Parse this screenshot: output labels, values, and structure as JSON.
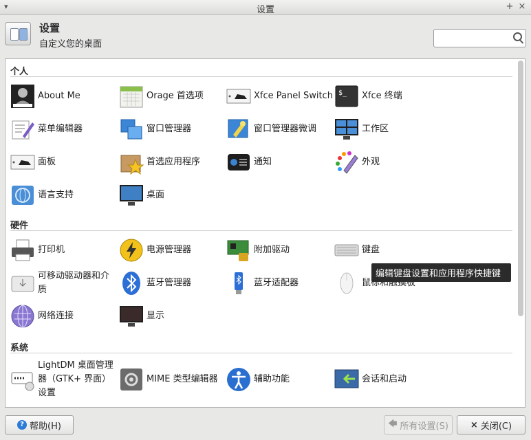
{
  "window": {
    "title": "设置"
  },
  "header": {
    "title": "设置",
    "subtitle": "自定义您的桌面",
    "search_placeholder": ""
  },
  "sections": [
    {
      "title": "个人",
      "items": [
        {
          "label": "About Me",
          "icon": "about-me-icon"
        },
        {
          "label": "Orage 首选项",
          "icon": "calendar-icon"
        },
        {
          "label": "Xfce Panel Switch",
          "icon": "panel-switch-icon"
        },
        {
          "label": "Xfce 终端",
          "icon": "terminal-icon"
        },
        {
          "label": "菜单编辑器",
          "icon": "menu-editor-icon"
        },
        {
          "label": "窗口管理器",
          "icon": "window-manager-icon"
        },
        {
          "label": "窗口管理器微调",
          "icon": "window-tweaks-icon"
        },
        {
          "label": "工作区",
          "icon": "workspaces-icon"
        },
        {
          "label": "面板",
          "icon": "panel-icon"
        },
        {
          "label": "首选应用程序",
          "icon": "preferred-apps-icon"
        },
        {
          "label": "通知",
          "icon": "notifications-icon"
        },
        {
          "label": "外观",
          "icon": "appearance-icon"
        },
        {
          "label": "语言支持",
          "icon": "language-icon"
        },
        {
          "label": "桌面",
          "icon": "desktop-icon"
        }
      ]
    },
    {
      "title": "硬件",
      "items": [
        {
          "label": "打印机",
          "icon": "printer-icon"
        },
        {
          "label": "电源管理器",
          "icon": "power-icon"
        },
        {
          "label": "附加驱动",
          "icon": "drivers-icon"
        },
        {
          "label": "键盘",
          "icon": "keyboard-icon"
        },
        {
          "label": "可移动驱动器和介质",
          "icon": "removable-drive-icon"
        },
        {
          "label": "蓝牙管理器",
          "icon": "bluetooth-icon"
        },
        {
          "label": "蓝牙适配器",
          "icon": "bluetooth-adapter-icon"
        },
        {
          "label": "鼠标和触摸板",
          "icon": "mouse-icon"
        },
        {
          "label": "网络连接",
          "icon": "network-icon"
        },
        {
          "label": "显示",
          "icon": "display-icon"
        }
      ]
    },
    {
      "title": "系统",
      "items": [
        {
          "label": "LightDM 桌面管理器（GTK+ 界面）设置",
          "icon": "lightdm-icon"
        },
        {
          "label": "MIME 类型编辑器",
          "icon": "mime-icon"
        },
        {
          "label": "辅助功能",
          "icon": "accessibility-icon"
        },
        {
          "label": "会话和启动",
          "icon": "session-icon"
        }
      ]
    }
  ],
  "tooltip": "编辑键盘设置和应用程序快捷键",
  "buttons": {
    "help": "帮助(H)",
    "all_settings": "所有设置(S)",
    "close": "关闭(C)"
  }
}
